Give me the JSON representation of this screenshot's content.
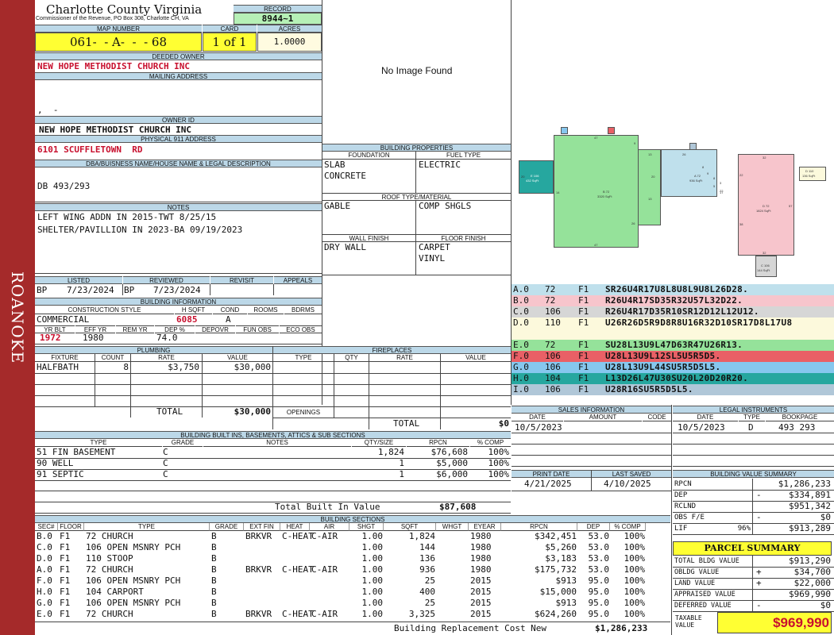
{
  "sidebar": {
    "label": "ROANOKE"
  },
  "header": {
    "county": "Charlotte County Virginia",
    "commissioner": "Commissioner of the Revenue, PO Box 308, Charlotte CH, VA",
    "record_label": "RECORD",
    "record": "8944~1",
    "map_label": "MAP NUMBER",
    "map": "061-  - A-  -  - 68",
    "card_label": "CARD",
    "card": "1 of 1",
    "acres_label": "ACRES",
    "acres": "1.0000"
  },
  "owner": {
    "deeded_label": "DEEDED OWNER",
    "deeded": "NEW HOPE METHODIST CHURCH INC",
    "mailing_label": "MAILING ADDRESS",
    "mailing": ",  -",
    "owner_id_label": "OWNER ID",
    "owner_id": "NEW HOPE METHODIST CHURCH INC",
    "physical_label": "PHYSICAL 911 ADDRESS",
    "physical": "6101 SCUFFLETOWN  RD",
    "dba_label": "DBA/BUISNESS NAME/HOUSE NAME & LEGAL DESCRIPTION",
    "dba": "DB 493/293",
    "notes_label": "NOTES",
    "notes": [
      "LEFT WING ADDN IN 2015-TWT 8/25/15",
      "SHELTER/PAVILLION IN 2023-BA 09/19/2023"
    ]
  },
  "image": {
    "no_image": "No Image Found"
  },
  "building_props": {
    "title": "BUILDING PROPERTIES",
    "foundation_label": "FOUNDATION",
    "fuel_label": "FUEL TYPE",
    "foundation": [
      "SLAB",
      "CONCRETE"
    ],
    "fuel": "ELECTRIC",
    "roof_label": "ROOF TYPE/MATERIAL",
    "roof_type": "GABLE",
    "roof_mat": "COMP SHGLS",
    "wall_label": "WALL FINISH",
    "floor_label": "FLOOR FINISH",
    "wall": "DRY WALL",
    "floor": [
      "CARPET",
      "VINYL"
    ]
  },
  "dates": {
    "listed_label": "LISTED",
    "listed_bp": "BP",
    "listed": "7/23/2024",
    "reviewed_label": "REVIEWED",
    "reviewed_bp": "BP",
    "reviewed": "7/23/2024",
    "revisit_label": "REVISIT",
    "appeals_label": "APPEALS"
  },
  "building_info": {
    "title": "BUILDING INFORMATION",
    "style_label": "CONSTRUCTION STYLE",
    "hsqft_label": "H SQFT",
    "cond_label": "COND",
    "rooms_label": "ROOMS",
    "bdrms_label": "BDRMS",
    "style": "COMMERCIAL",
    "hsqft": "6085",
    "cond": "A",
    "yrblt_label": "YR BLT",
    "effyr_label": "EFF YR",
    "remyr_label": "REM YR",
    "dep_label": "DEP %",
    "depovr_label": "DEPOVR",
    "funobs_label": "FUN OBS",
    "ecoobs_label": "ECO OBS",
    "yrblt": "1972",
    "effyr": "1980",
    "dep": "74.0"
  },
  "plumbing": {
    "title": "PLUMBING",
    "headers": [
      "FIXTURE",
      "COUNT",
      "RATE",
      "VALUE"
    ],
    "rows": [
      [
        "HALFBATH",
        "8",
        "$3,750",
        "$30,000"
      ]
    ],
    "total_label": "TOTAL",
    "total": "$30,000"
  },
  "fireplaces": {
    "title": "FIREPLACES",
    "headers": [
      "TYPE",
      "QTY",
      "RATE",
      "VALUE"
    ],
    "openings_label": "OPENINGS",
    "total_label": "TOTAL",
    "total": "$0"
  },
  "built_ins": {
    "title": "BUILDING BUILT INS, BASEMENTS, ATTICS & SUB SECTIONS",
    "headers": [
      "TYPE",
      "GRADE",
      "NOTES",
      "QTY/SIZE",
      "RPCN",
      "% COMP"
    ],
    "rows": [
      [
        "51 FIN BASEMENT",
        "C",
        "",
        "1,824",
        "$76,608",
        "100%"
      ],
      [
        "90 WELL",
        "C",
        "",
        "1",
        "$5,000",
        "100%"
      ],
      [
        "91 SEPTIC",
        "C",
        "",
        "1",
        "$6,000",
        "100%"
      ]
    ],
    "total_label": "Total Built In Value",
    "total": "$87,608"
  },
  "sketch": {
    "labels": [
      [
        "B 72",
        "3320 SqFt"
      ],
      [
        "A 72",
        "936 SqFt"
      ],
      [
        "D 72",
        "1824 SqFt"
      ],
      [
        "E 106",
        "432 SqFt"
      ],
      [
        "C 106",
        "144 SqFt"
      ],
      [
        "D 110",
        "136 SqFt"
      ]
    ],
    "dims": [
      "47",
      "47",
      "9",
      "13",
      "13",
      "20",
      "20",
      "26",
      "26",
      "8",
      "32",
      "32",
      "22",
      "22",
      "57",
      "38",
      "17",
      "5",
      "14",
      "9",
      "8",
      "3"
    ]
  },
  "vectors": [
    {
      "code": "A.0",
      "id": "72",
      "fl": "F1",
      "path": "SR26U4R17U8L8U8L9U8L26D28.",
      "bg": "#bfe0ec"
    },
    {
      "code": "B.0",
      "id": "72",
      "fl": "F1",
      "path": "R26U4R17SD35R32U57L32D22.",
      "bg": "#f7c5cc"
    },
    {
      "code": "C.0",
      "id": "106",
      "fl": "F1",
      "path": "R26U4R17D35R10SR12D12L12U12.",
      "bg": "#d6d6d6"
    },
    {
      "code": "D.0",
      "id": "110",
      "fl": "F1",
      "path": "U26R26D5R9D8R8U16R32D10SR17D8L17U8",
      "bg": "#fcf9dc"
    },
    {
      "code": "E.0",
      "id": "72",
      "fl": "F1",
      "path": "SU28L13U9L47D63R47U26R13.",
      "bg": "#95e29a"
    },
    {
      "code": "F.0",
      "id": "106",
      "fl": "F1",
      "path": "U28L13U9L12SL5U5R5D5.",
      "bg": "#e96066"
    },
    {
      "code": "G.0",
      "id": "106",
      "fl": "F1",
      "path": "U28L13U9L44SU5R5D5L5.",
      "bg": "#86c7ee"
    },
    {
      "code": "H.0",
      "id": "104",
      "fl": "F1",
      "path": "L13D26L47U30SU20L20D20R20.",
      "bg": "#26a79f"
    },
    {
      "code": "I.0",
      "id": "106",
      "fl": "F1",
      "path": "U28R16SU5R5D5L5.",
      "bg": "#b0c7d8"
    }
  ],
  "sales": {
    "title": "SALES INFORMATION",
    "headers": [
      "DATE",
      "AMOUNT",
      "CODE"
    ],
    "rows": [
      [
        "10/5/2023",
        "",
        ""
      ]
    ]
  },
  "legal": {
    "title": "LEGAL INSTRUMENTS",
    "headers": [
      "DATE",
      "TYPE",
      "BOOKPAGE"
    ],
    "rows": [
      [
        "10/5/2023",
        "D",
        "493 293"
      ]
    ]
  },
  "print": {
    "print_label": "PRINT DATE",
    "print": "4/21/2025",
    "saved_label": "LAST SAVED",
    "saved": "4/10/2025"
  },
  "value_summary": {
    "title": "BUILDING VALUE SUMMARY",
    "rows": [
      {
        "label": "RPCN",
        "sign": "",
        "value": "$1,286,233"
      },
      {
        "label": "DEP",
        "sign": "-",
        "value": "$334,891"
      },
      {
        "label": "RCLND",
        "sign": "",
        "value": "$951,342"
      },
      {
        "label": "OBS F/E",
        "sign": "-",
        "value": "$0"
      },
      {
        "label": "LIF",
        "pct": "96%",
        "value": "$913,289"
      }
    ]
  },
  "parcel": {
    "title": "PARCEL SUMMARY",
    "rows": [
      {
        "label": "TOTAL BLDG VALUE",
        "sign": "",
        "value": "$913,290"
      },
      {
        "label": "OBLDG VALUE",
        "sign": "+",
        "value": "$34,700"
      },
      {
        "label": "LAND VALUE",
        "sign": "+",
        "value": "$22,000"
      },
      {
        "label": "APPRAISED VALUE",
        "sign": "",
        "value": "$969,990"
      },
      {
        "label": "DEFERRED VALUE",
        "sign": "-",
        "value": "$0"
      }
    ],
    "taxable_label": "TAXABLE VALUE",
    "taxable": "$969,990"
  },
  "sections": {
    "title": "BUILDING SECTIONS",
    "headers": [
      "SEC#",
      "FLOOR",
      "TYPE",
      "GRADE",
      "EXT FIN",
      "HEAT",
      "AIR",
      "SHGT",
      "SQFT",
      "WHGT",
      "EYEAR",
      "RPCN",
      "DEP",
      "% COMP"
    ],
    "rows": [
      [
        "B.0",
        "F1",
        "72 CHURCH",
        "B",
        "BRKVR",
        "C-HEAT",
        "C-AIR",
        "1.00",
        "1,824",
        "",
        "1980",
        "$342,451",
        "53.0",
        "100%"
      ],
      [
        "C.0",
        "F1",
        "106 OPEN MSNRY PCH",
        "B",
        "",
        "",
        "",
        "1.00",
        "144",
        "",
        "1980",
        "$5,260",
        "53.0",
        "100%"
      ],
      [
        "D.0",
        "F1",
        "110 STOOP",
        "B",
        "",
        "",
        "",
        "1.00",
        "136",
        "",
        "1980",
        "$3,183",
        "53.0",
        "100%"
      ],
      [
        "A.0",
        "F1",
        "72 CHURCH",
        "B",
        "BRKVR",
        "C-HEAT",
        "C-AIR",
        "1.00",
        "936",
        "",
        "1980",
        "$175,732",
        "53.0",
        "100%"
      ],
      [
        "F.0",
        "F1",
        "106 OPEN MSNRY PCH",
        "B",
        "",
        "",
        "",
        "1.00",
        "25",
        "",
        "2015",
        "$913",
        "95.0",
        "100%"
      ],
      [
        "H.0",
        "F1",
        "104 CARPORT",
        "B",
        "",
        "",
        "",
        "1.00",
        "400",
        "",
        "2015",
        "$15,000",
        "95.0",
        "100%"
      ],
      [
        "G.0",
        "F1",
        "106 OPEN MSNRY PCH",
        "B",
        "",
        "",
        "",
        "1.00",
        "25",
        "",
        "2015",
        "$913",
        "95.0",
        "100%"
      ],
      [
        "E.0",
        "F1",
        "72 CHURCH",
        "B",
        "BRKVR",
        "C-HEAT",
        "C-AIR",
        "1.00",
        "3,325",
        "",
        "2015",
        "$624,260",
        "95.0",
        "100%"
      ]
    ],
    "total_label": "Building Replacement Cost New",
    "total": "$1,286,233"
  }
}
